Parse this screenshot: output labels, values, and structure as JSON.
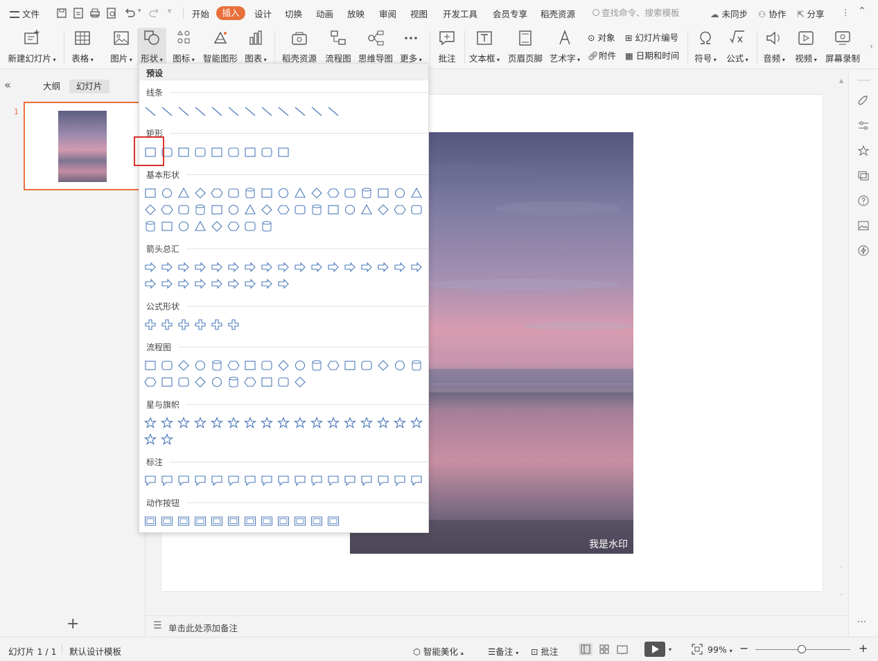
{
  "menubar": {
    "file_label": "文件",
    "tabs": [
      "开始",
      "插入",
      "设计",
      "切换",
      "动画",
      "放映",
      "审阅",
      "视图",
      "开发工具",
      "会员专享",
      "稻壳资源"
    ],
    "active_tab": "插入",
    "search_placeholder": "查找命令、搜索模板",
    "sync_label": "未同步",
    "collab_label": "协作",
    "share_label": "分享"
  },
  "ribbon": {
    "new_slide": "新建幻灯片",
    "table": "表格",
    "picture": "图片",
    "shape": "形状",
    "icon": "图标",
    "smart_graphic": "智能图形",
    "chart": "图表",
    "docer_resource": "稻壳资源",
    "flowchart": "流程图",
    "mindmap": "思维导图",
    "more": "更多",
    "comment": "批注",
    "textbox": "文本框",
    "header_footer": "页眉页脚",
    "art_text": "艺术字",
    "object": "对象",
    "attachment": "附件",
    "slide_number": "幻灯片编号",
    "date_time": "日期和时间",
    "symbol": "符号",
    "formula": "公式",
    "audio": "音频",
    "video": "视频",
    "screen_record": "屏幕录制"
  },
  "leftpanel": {
    "outline_tab": "大纲",
    "slides_tab": "幻灯片",
    "slide_number": "1"
  },
  "canvas": {
    "watermark": "我是水印",
    "notes_placeholder": "单击此处添加备注"
  },
  "shapes_panel": {
    "preset_label": "预设",
    "sections": [
      {
        "title": "线条",
        "count": 12
      },
      {
        "title": "矩形",
        "count": 9
      },
      {
        "title": "基本形状",
        "count": 42
      },
      {
        "title": "箭头总汇",
        "count": 26
      },
      {
        "title": "公式形状",
        "count": 6
      },
      {
        "title": "流程图",
        "count": 27
      },
      {
        "title": "星与旗帜",
        "count": 19
      },
      {
        "title": "标注",
        "count": 17
      },
      {
        "title": "动作按钮",
        "count": 12
      }
    ],
    "highlighted_shape": "rectangle"
  },
  "statusbar": {
    "slide_info": "幻灯片 1 / 1",
    "template": "默认设计模板",
    "smart_beautify": "智能美化",
    "notes": "备注",
    "comments": "批注",
    "zoom": "99%"
  },
  "colors": {
    "accent": "#e8703a",
    "shape_stroke": "#4a78b8",
    "highlight": "#d9302a"
  }
}
